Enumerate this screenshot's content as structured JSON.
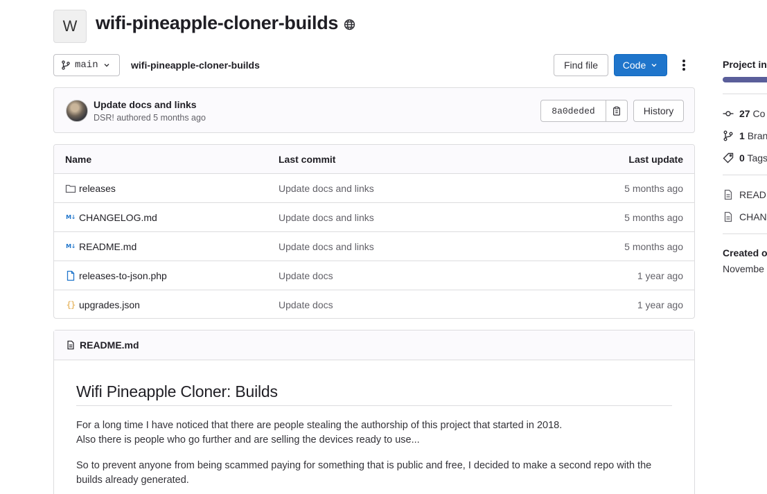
{
  "project": {
    "avatar_letter": "W",
    "name": "wifi-pineapple-cloner-builds"
  },
  "toolbar": {
    "branch": "main",
    "breadcrumb": "wifi-pineapple-cloner-builds",
    "find_file": "Find file",
    "code": "Code"
  },
  "last_commit": {
    "title": "Update docs and links",
    "author": "DSR!",
    "authored_text": " authored 5 months ago",
    "sha": "8a0deded",
    "history": "History"
  },
  "file_table": {
    "headers": {
      "name": "Name",
      "last_commit": "Last commit",
      "last_update": "Last update"
    },
    "rows": [
      {
        "icon": "folder-icon",
        "name": "releases",
        "commit": "Update docs and links",
        "date": "5 months ago"
      },
      {
        "icon": "markdown-icon",
        "name": "CHANGELOG.md",
        "commit": "Update docs and links",
        "date": "5 months ago"
      },
      {
        "icon": "markdown-icon",
        "name": "README.md",
        "commit": "Update docs and links",
        "date": "5 months ago"
      },
      {
        "icon": "file-icon",
        "name": "releases-to-json.php",
        "commit": "Update docs",
        "date": "1 year ago"
      },
      {
        "icon": "json-icon",
        "name": "upgrades.json",
        "commit": "Update docs",
        "date": "1 year ago"
      }
    ]
  },
  "readme": {
    "filename": "README.md",
    "heading": "Wifi Pineapple Cloner: Builds",
    "p1_line1": "For a long time I have noticed that there are people stealing the authorship of this project that started in 2018.",
    "p1_line2": "Also there is people who go further and are selling the devices ready to use...",
    "p2": "So to prevent anyone from being scammed paying for something that is public and free, I decided to make a second repo with the builds already generated."
  },
  "sidebar": {
    "title": "Project in",
    "commits_count": "27",
    "commits_label": "Co",
    "branches_count": "1",
    "branches_label": "Bran",
    "tags_count": "0",
    "tags_label": "Tags",
    "readme_link": "READM",
    "changelog_link": "CHANG",
    "created_label": "Created o",
    "created_date": "Novembe"
  },
  "colors": {
    "primary_button": "#1f75cb",
    "language_bar": "#5a5e9a"
  }
}
